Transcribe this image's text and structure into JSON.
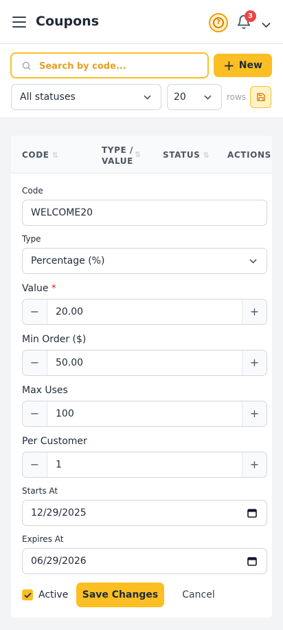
{
  "header": {
    "title": "Coupons",
    "notification_count": "3",
    "icons": [
      "menu-icon",
      "help-icon",
      "bell-icon",
      "chevron-down-icon"
    ]
  },
  "toolbar": {
    "search_placeholder": "Search by code...",
    "new_label": "New",
    "status_filter": "All statuses",
    "rows_per_page": "20",
    "rows_label": "rows"
  },
  "table": {
    "columns": [
      "CODE",
      "TYPE /",
      "VALUE",
      "STATUS",
      "ACTIONS"
    ]
  },
  "form": {
    "code_label": "Code",
    "code_value": "WELCOME20",
    "type_label": "Type",
    "type_value": "Percentage (%)",
    "value_label": "Value",
    "value_required": "*",
    "value_value": "20.00",
    "min_order_label": "Min Order ($)",
    "min_order_value": "50.00",
    "max_uses_label": "Max Uses",
    "max_uses_value": "100",
    "per_customer_label": "Per Customer",
    "per_customer_value": "1",
    "starts_label": "Starts At",
    "starts_value": "12/29/2025",
    "expires_label": "Expires At",
    "expires_value": "06/29/2026",
    "active_label": "Active",
    "active_checked": true,
    "save_label": "Save Changes",
    "cancel_label": "Cancel",
    "minus": "−",
    "plus": "+"
  },
  "colors": {
    "accent": "#fbbf24",
    "accent_text": "#d97706",
    "badge": "#ef4444"
  }
}
